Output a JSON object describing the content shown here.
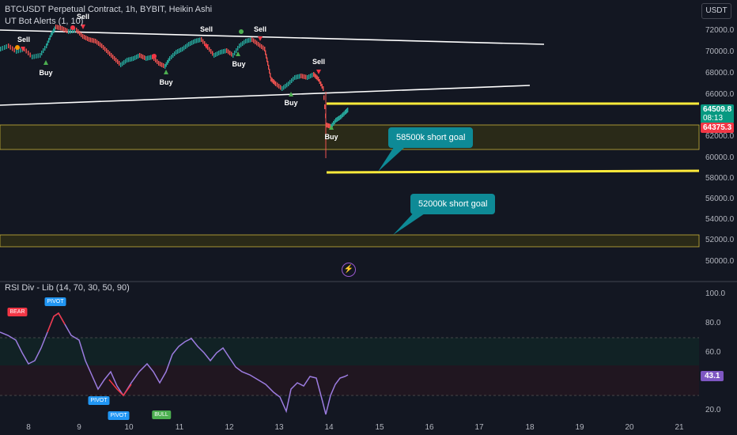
{
  "header": {
    "symbol_line": "BTCUSDT Perpetual Contract, 1h, BYBIT, Heikin Ashi",
    "indicator_line": "UT Bot Alerts (1, 10)",
    "currency": "USDT"
  },
  "price_axis": {
    "labels": [
      "72000.0",
      "70000.0",
      "68000.0",
      "66000.0",
      "62000.0",
      "60000.0",
      "58000.0",
      "56000.0",
      "54000.0",
      "52000.0",
      "50000.0"
    ],
    "last_price": "64509.8",
    "countdown": "08:13",
    "other_price": "64375.3",
    "colors": {
      "last_price_bg": "#089981",
      "other_price_bg": "#f23645"
    }
  },
  "time_axis": {
    "labels": [
      "8",
      "9",
      "10",
      "11",
      "12",
      "13",
      "14",
      "15",
      "16",
      "17",
      "18",
      "19",
      "20",
      "21"
    ]
  },
  "signals": [
    {
      "type": "sell",
      "label": "Sell"
    },
    {
      "type": "buy",
      "label": "Buy"
    },
    {
      "type": "sell",
      "label": "Sell"
    },
    {
      "type": "buy",
      "label": "Buy"
    },
    {
      "type": "sell",
      "label": "Sell"
    },
    {
      "type": "buy",
      "label": "Buy"
    },
    {
      "type": "sell",
      "label": "Sell"
    },
    {
      "type": "buy",
      "label": "Buy"
    },
    {
      "type": "sell",
      "label": "Sell"
    },
    {
      "type": "buy",
      "label": "Buy"
    }
  ],
  "annotations": {
    "goal_1": "58500k short goal",
    "goal_2": "52000k short goal"
  },
  "rsi_panel": {
    "title": "RSI Div - Lib (14, 70, 30, 50, 90)",
    "labels": [
      "100.0",
      "80.0",
      "60.0",
      "20.0"
    ],
    "current_value": "43.1",
    "tags": [
      {
        "label": "BEAR",
        "color": "#f23645"
      },
      {
        "label": "PIVOT",
        "color": "#2196f3"
      },
      {
        "label": "PIVOT",
        "color": "#2196f3"
      },
      {
        "label": "PIVOT",
        "color": "#2196f3"
      },
      {
        "label": "BULL",
        "color": "#4caf50"
      }
    ],
    "colors": {
      "line": "#9c7ce0",
      "value_bg": "#7e57c2"
    }
  }
}
